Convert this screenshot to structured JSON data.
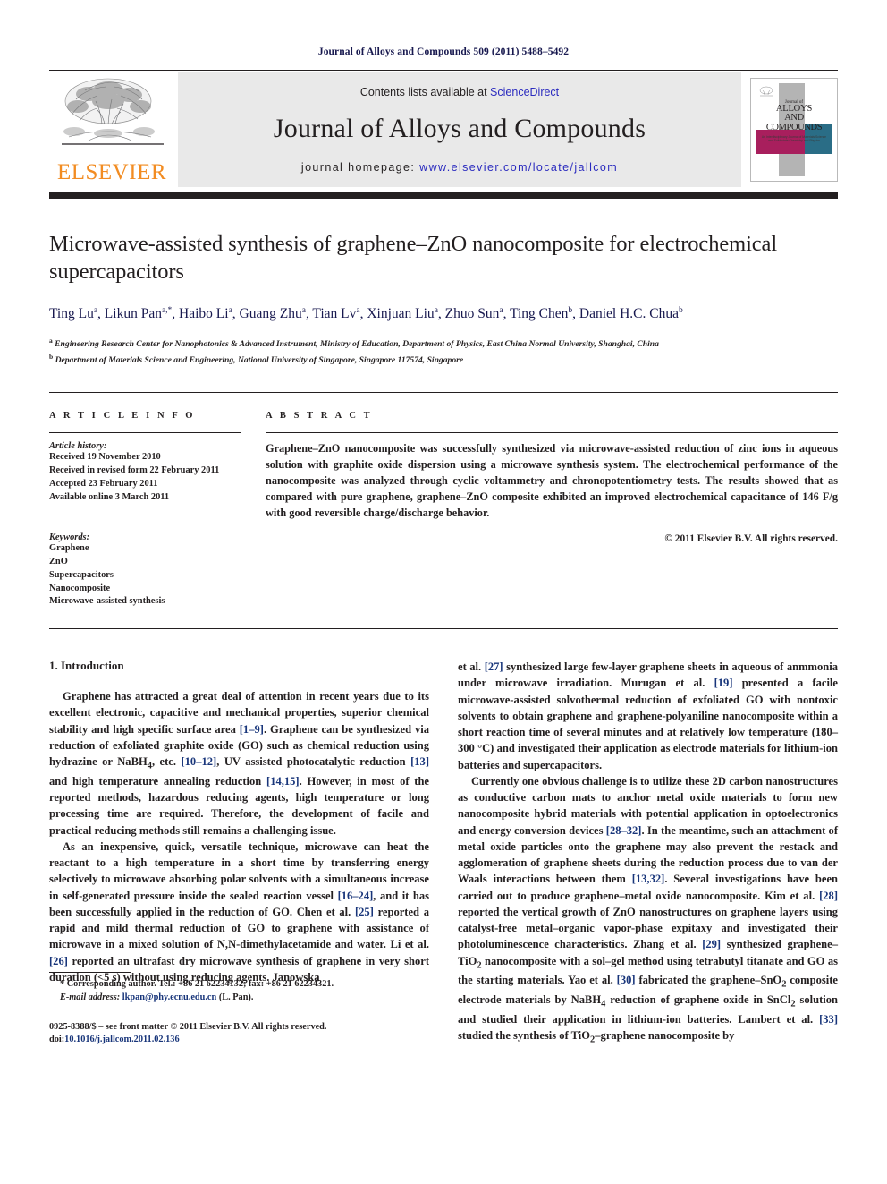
{
  "running_head": "Journal of Alloys and Compounds 509 (2011) 5488–5492",
  "masthead": {
    "publisher": "ELSEVIER",
    "contents_prefix": "Contents lists available at ",
    "contents_link": "ScienceDirect",
    "journal_title": "Journal of Alloys and Compounds",
    "homepage_prefix": "journal homepage: ",
    "homepage_url": "www.elsevier.com/locate/jallcom",
    "cover": {
      "line1": "Journal of",
      "line2": "ALLOYS",
      "line3": "AND COMPOUNDS",
      "line4": "An Interdisciplinary Journal of Materials Science and Solid-state Chemistry and Physics"
    },
    "link_color": "#2b2bbf",
    "elsevier_orange": "#f28c22",
    "bar_color": "#231f20"
  },
  "article": {
    "title": "Microwave-assisted synthesis of graphene–ZnO nanocomposite for electrochemical supercapacitors",
    "authors_line1": "Ting Lu",
    "authors_html": "Ting Lu<sup>a</sup>, Likun Pan<sup>a,*</sup>, Haibo Li<sup>a</sup>, Guang Zhu<sup>a</sup>, Tian Lv<sup>a</sup>, Xinjuan Liu<sup>a</sup>, Zhuo Sun<sup>a</sup>, Ting Chen<sup>b</sup>, Daniel H.C. Chua<sup>b</sup>",
    "affiliation_a": "Engineering Research Center for Nanophotonics & Advanced Instrument, Ministry of Education, Department of Physics, East China Normal University, Shanghai, China",
    "affiliation_b": "Department of Materials Science and Engineering, National University of Singapore, Singapore 117574, Singapore"
  },
  "article_info": {
    "label": "A R T I C L E   I N F O",
    "history_head": "Article history:",
    "history": [
      "Received 19 November 2010",
      "Received in revised form 22 February 2011",
      "Accepted 23 February 2011",
      "Available online 3 March 2011"
    ],
    "keywords_head": "Keywords:",
    "keywords": [
      "Graphene",
      "ZnO",
      "Supercapacitors",
      "Nanocomposite",
      "Microwave-assisted synthesis"
    ]
  },
  "abstract": {
    "label": "A B S T R A C T",
    "text": "Graphene–ZnO nanocomposite was successfully synthesized via microwave-assisted reduction of zinc ions in aqueous solution with graphite oxide dispersion using a microwave synthesis system. The electrochemical performance of the nanocomposite was analyzed through cyclic voltammetry and chronopotentiometry tests. The results showed that as compared with pure graphene, graphene–ZnO composite exhibited an improved electrochemical capacitance of 146 F/g with good reversible charge/discharge behavior.",
    "copyright": "© 2011 Elsevier B.V. All rights reserved."
  },
  "body": {
    "section_heading": "1. Introduction",
    "left_para_1_html": "Graphene has attracted a great deal of attention in recent years due to its excellent electronic, capacitive and mechanical properties, superior chemical stability and high specific surface area <span class=\"ref\">[1–9]</span>. Graphene can be synthesized via reduction of exfoliated graphite oxide (GO) such as chemical reduction using hydrazine or NaBH<sub>4</sub>, etc. <span class=\"ref\">[10–12]</span>, UV assisted photocatalytic reduction <span class=\"ref\">[13]</span> and high temperature annealing reduction <span class=\"ref\">[14,15]</span>. However, in most of the reported methods, hazardous reducing agents, high temperature or long processing time are required. Therefore, the development of facile and practical reducing methods still remains a challenging issue.",
    "left_para_2_html": "As an inexpensive, quick, versatile technique, microwave can heat the reactant to a high temperature in a short time by transferring energy selectively to microwave absorbing polar solvents with a simultaneous increase in self-generated pressure inside the sealed reaction vessel <span class=\"ref\">[16–24]</span>, and it has been successfully applied in the reduction of GO. Chen et al. <span class=\"ref\">[25]</span> reported a rapid and mild thermal reduction of GO to graphene with assistance of microwave in a mixed solution of N,N-dimethylacetamide and water. Li et al. <span class=\"ref\">[26]</span> reported an ultrafast dry microwave synthesis of graphene in very short duration (&lt;5 s) without using reducing agents. Janowska",
    "right_para_1_html": "et al. <span class=\"ref\">[27]</span> synthesized large few-layer graphene sheets in aqueous of anmmonia under microwave irradiation. Murugan et al. <span class=\"ref\">[19]</span> presented a facile microwave-assisted solvothermal reduction of exfoliated GO with nontoxic solvents to obtain graphene and graphene-polyaniline nanocomposite within a short reaction time of several minutes and at relatively low temperature (180–300 °C) and investigated their application as electrode materials for lithium-ion batteries and supercapacitors.",
    "right_para_2_html": "Currently one obvious challenge is to utilize these 2D carbon nanostructures as conductive carbon mats to anchor metal oxide materials to form new nanocomposite hybrid materials with potential application in optoelectronics and energy conversion devices <span class=\"ref\">[28–32]</span>. In the meantime, such an attachment of metal oxide particles onto the graphene may also prevent the restack and agglomeration of graphene sheets during the reduction process due to van der Waals interactions between them <span class=\"ref\">[13,32]</span>. Several investigations have been carried out to produce graphene–metal oxide nanocomposite. Kim et al. <span class=\"ref\">[28]</span> reported the vertical growth of ZnO nanostructures on graphene layers using catalyst-free metal–organic vapor-phase expitaxy and investigated their photoluminescence characteristics. Zhang et al. <span class=\"ref\">[29]</span> synthesized graphene–TiO<sub>2</sub> nanocomposite with a sol–gel method using tetrabutyl titanate and GO as the starting materials. Yao et al. <span class=\"ref\">[30]</span> fabricated the graphene–SnO<sub>2</sub> composite electrode materials by NaBH<sub>4</sub> reduction of graphene oxide in SnCl<sub>2</sub> solution and studied their application in lithium-ion batteries. Lambert et al. <span class=\"ref\">[33]</span> studied the synthesis of TiO<sub>2</sub>–graphene nanocomposite by"
  },
  "footnote": {
    "corresponding_html": "* Corresponding author. Tel.: +86 21 62234132; fax: +86 21 62234321.",
    "email_label": "E-mail address:",
    "email": "lkpan@phy.ecnu.edu.cn",
    "email_suffix": "(L. Pan)."
  },
  "imprint": {
    "issn_line": "0925-8388/$ – see front matter © 2011 Elsevier B.V. All rights reserved.",
    "doi_prefix": "doi:",
    "doi": "10.1016/j.jallcom.2011.02.136"
  }
}
